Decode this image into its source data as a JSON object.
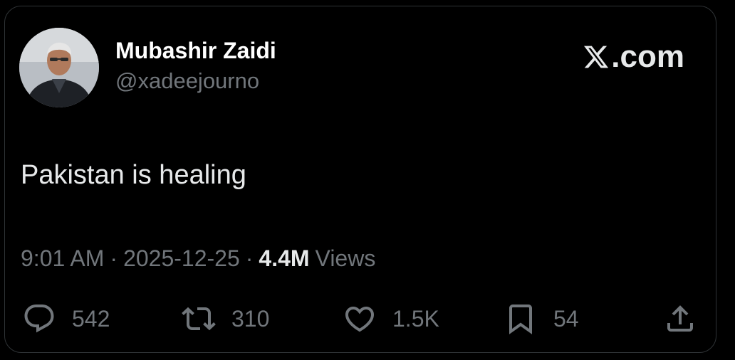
{
  "author": {
    "display_name": "Mubashir Zaidi",
    "handle": "@xadeejourno"
  },
  "brand": {
    "label": ".com",
    "icon": "x-logo-icon"
  },
  "tweet": {
    "text": "Pakistan is healing"
  },
  "meta": {
    "time": "9:01 AM",
    "separator": "·",
    "date": "2025-12-25",
    "views_count": "4.4M",
    "views_label": "Views"
  },
  "actions": {
    "reply": {
      "icon": "reply-icon",
      "count": "542"
    },
    "repost": {
      "icon": "repost-icon",
      "count": "310"
    },
    "like": {
      "icon": "heart-icon",
      "count": "1.5K"
    },
    "bookmark": {
      "icon": "bookmark-icon",
      "count": "54"
    },
    "share": {
      "icon": "share-icon"
    }
  },
  "colors": {
    "background": "#000000",
    "primary_text": "#e7e9ea",
    "secondary_text": "#71767b",
    "border": "#2f3336"
  }
}
